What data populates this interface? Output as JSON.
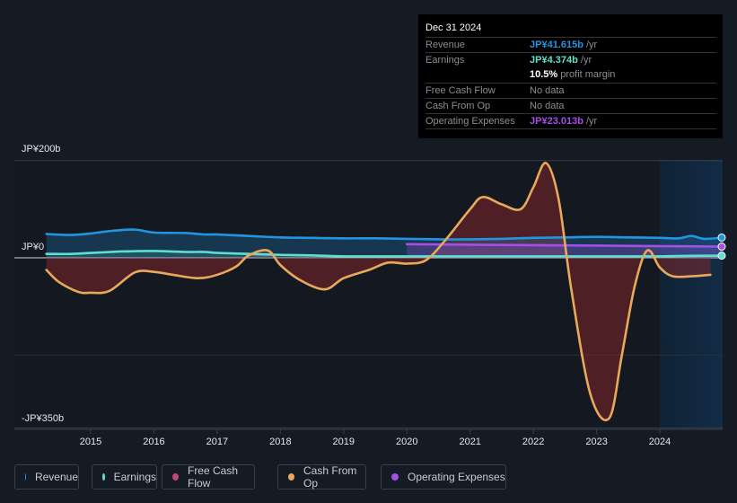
{
  "tooltip": {
    "date": "Dec 31 2024",
    "rows": [
      {
        "label": "Revenue",
        "value": "JP¥41.615b",
        "suffix": " /yr",
        "color": "#2394df"
      },
      {
        "label": "Earnings",
        "value": "JP¥4.374b",
        "suffix": " /yr",
        "color": "#5ee0cf"
      },
      {
        "label": "",
        "value": "10.5%",
        "suffix": " profit margin",
        "color": "#ffffff"
      },
      {
        "label": "Free Cash Flow",
        "value": "",
        "suffix": "No data",
        "color": "#8a8d92"
      },
      {
        "label": "Cash From Op",
        "value": "",
        "suffix": "No data",
        "color": "#8a8d92"
      },
      {
        "label": "Operating Expenses",
        "value": "JP¥23.013b",
        "suffix": " /yr",
        "color": "#a64ee8"
      }
    ]
  },
  "legend": [
    {
      "label": "Revenue",
      "color": "#2394df"
    },
    {
      "label": "Earnings",
      "color": "#5ee0cf"
    },
    {
      "label": "Free Cash Flow",
      "color": "#c2457c"
    },
    {
      "label": "Cash From Op",
      "color": "#e8a95a"
    },
    {
      "label": "Operating Expenses",
      "color": "#a64ee8"
    }
  ],
  "chart_data": {
    "type": "area",
    "title": "",
    "xlabel": "",
    "ylabel": "",
    "y_tick_labels": [
      "JP¥200b",
      "JP¥0",
      "-JP¥350b"
    ],
    "y_ticks": [
      200,
      0,
      -350
    ],
    "ylim": [
      -350,
      200
    ],
    "x_ticks": [
      2015,
      2016,
      2017,
      2018,
      2019,
      2020,
      2021,
      2022,
      2023,
      2024
    ],
    "xlim": [
      2014.3,
      2025.0
    ],
    "forecast_start": 2024.0,
    "series": [
      {
        "name": "Revenue",
        "color": "#2394df",
        "x": [
          2014.3,
          2014.7,
          2015.0,
          2015.3,
          2015.7,
          2016.0,
          2016.5,
          2016.8,
          2017.0,
          2017.5,
          2018.0,
          2018.5,
          2019.0,
          2019.5,
          2020.0,
          2020.5,
          2021.0,
          2021.5,
          2022.0,
          2022.5,
          2023.0,
          2023.5,
          2024.0,
          2024.3,
          2024.5,
          2024.7,
          2025.0
        ],
        "values": [
          49,
          47,
          50,
          55,
          58,
          52,
          51,
          48,
          48,
          45,
          42,
          41,
          40,
          40,
          39,
          38,
          38,
          39,
          41,
          42,
          43,
          42,
          41,
          40,
          45,
          39,
          41.6
        ]
      },
      {
        "name": "Earnings",
        "color": "#5ee0cf",
        "x": [
          2014.3,
          2014.7,
          2015.0,
          2015.5,
          2016.0,
          2016.5,
          2016.8,
          2017.0,
          2017.5,
          2018.0,
          2018.5,
          2019.0,
          2019.5,
          2020.0,
          2020.5,
          2021.0,
          2021.5,
          2022.0,
          2022.5,
          2023.0,
          2023.5,
          2024.0,
          2024.5,
          2025.0
        ],
        "values": [
          8,
          8,
          10,
          13,
          14,
          12,
          12,
          10,
          8,
          6,
          5,
          3,
          3,
          3,
          3,
          3,
          3,
          3,
          3,
          3,
          3,
          3,
          4,
          4.4
        ]
      },
      {
        "name": "Operating Expenses",
        "color": "#a64ee8",
        "x": [
          2020.0,
          2021.0,
          2022.0,
          2023.0,
          2024.0,
          2025.0
        ],
        "values": [
          28,
          27,
          26,
          25,
          24,
          23
        ]
      },
      {
        "name": "Cash From Op",
        "color": "#e8a95a",
        "x": [
          2014.3,
          2014.5,
          2014.8,
          2015.0,
          2015.3,
          2015.7,
          2016.0,
          2016.3,
          2016.7,
          2017.0,
          2017.3,
          2017.5,
          2017.8,
          2018.0,
          2018.3,
          2018.7,
          2019.0,
          2019.4,
          2019.7,
          2020.0,
          2020.3,
          2020.6,
          2021.0,
          2021.2,
          2021.5,
          2021.8,
          2022.0,
          2022.2,
          2022.4,
          2022.6,
          2022.9,
          2023.2,
          2023.4,
          2023.6,
          2023.8,
          2024.0,
          2024.2,
          2024.5,
          2024.8
        ],
        "values": [
          -25,
          -50,
          -70,
          -72,
          -68,
          -30,
          -29,
          -35,
          -42,
          -35,
          -18,
          5,
          15,
          -15,
          -45,
          -65,
          -42,
          -25,
          -10,
          -12,
          -5,
          35,
          100,
          125,
          110,
          100,
          145,
          195,
          120,
          -65,
          -280,
          -330,
          -200,
          -60,
          15,
          -20,
          -38,
          -38,
          -35
        ]
      },
      {
        "name": "Free Cash Flow",
        "color": "#c2457c",
        "x": [],
        "values": []
      }
    ]
  }
}
